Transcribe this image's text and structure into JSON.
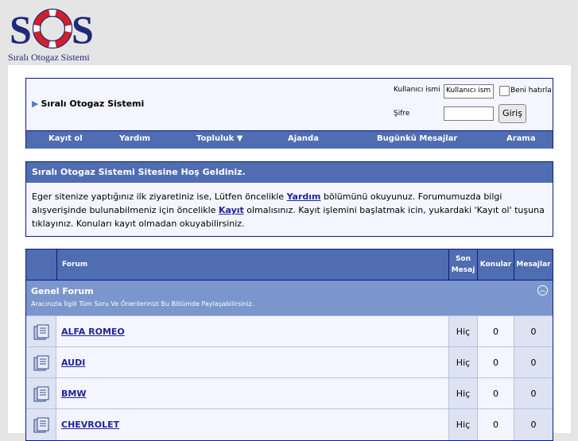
{
  "logo": {
    "mark": "SOS",
    "tagline": "Sıralı Otogaz Sistemi",
    "colors": {
      "navy": "#1e2a7a",
      "red": "#d0202a"
    }
  },
  "login": {
    "site_name": "Sıralı Otogaz Sistemi",
    "username_label": "Kullanıcı ismi",
    "username_value": "Kullanıcı ism",
    "remember_label": "Beni hatırla",
    "password_label": "Şifre",
    "login_button": "Giriş"
  },
  "navbar": {
    "register": "Kayıt ol",
    "help": "Yardım",
    "community": "Topluluk",
    "calendar": "Ajanda",
    "today_posts": "Bugünkü Mesajlar",
    "search": "Arama"
  },
  "welcome": {
    "title": "Sıralı Otogaz Sistemi Sitesine Hoş Geldiniz.",
    "text_1": "Eger sitenize yaptığınız ilk ziyaretiniz ise, Lütfen öncelikle ",
    "help_link": "Yardım",
    "text_2": " bölümünü okuyunuz. Forumumuzda bilgi alışverişinde bulunabilmeniz için öncelikle ",
    "register_link": "Kayıt",
    "text_3": " olmalısınız. Kayıt işlemini başlatmak icin, yukardaki 'Kayıt ol' tuşuna tıklayınız. Konuları kayıt olmadan okuyabilirsiniz."
  },
  "forum_table": {
    "headers": {
      "forum": "Forum",
      "last_post_1": "Son",
      "last_post_2": "Mesaj",
      "threads": "Konular",
      "posts": "Mesajlar"
    },
    "category": {
      "title": "Genel Forum",
      "description": "Aracınızla İlgili Tüm Soru Ve Önerilerinizi Bu Bölümde Paylaşabilirsiniz."
    },
    "rows": [
      {
        "name": "ALFA ROMEO",
        "last_post": "Hiç",
        "threads": "0",
        "posts": "0"
      },
      {
        "name": "AUDI",
        "last_post": "Hiç",
        "threads": "0",
        "posts": "0"
      },
      {
        "name": "BMW",
        "last_post": "Hiç",
        "threads": "0",
        "posts": "0"
      },
      {
        "name": "CHEVROLET",
        "last_post": "Hiç",
        "threads": "0",
        "posts": "0"
      }
    ]
  },
  "colors": {
    "nav_blue": "#4f6db0",
    "category_blue": "#7a96cc",
    "link": "#22229c",
    "border": "#0b198c"
  }
}
